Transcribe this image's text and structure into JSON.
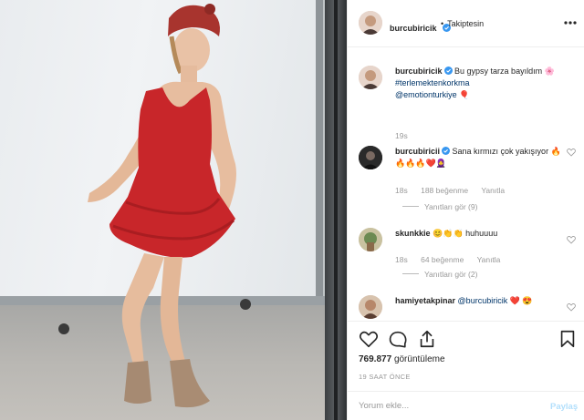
{
  "post": {
    "username": "burcubiricik",
    "follow_status": "Takiptesin",
    "caption": {
      "username": "burcubiricik",
      "text": "Bu gypsy tarza bayıldım 🌸",
      "hashtag": "#terlemektenkorkma",
      "mention": "@emotionturkiye 🎈",
      "age": "19s"
    }
  },
  "comments": [
    {
      "username": "burcubiricii",
      "text": "Sana kırmızı çok yakışıyor 🔥🔥🔥🔥❤️🧕",
      "age": "18s",
      "likes": "188 beğenme",
      "reply_label": "Yanıtla",
      "view_replies": "Yanıtları gör (9)"
    },
    {
      "username": "skunkkie",
      "text": "😊👏👏 huhuuuu",
      "age": "18s",
      "likes": "64 beğenme",
      "reply_label": "Yanıtla",
      "view_replies": "Yanıtları gör (2)"
    },
    {
      "username": "hamiyetakpinar",
      "mention": "@burcubiricik",
      "text": "❤️ 😍"
    }
  ],
  "stats": {
    "views_count": "769.877",
    "views_label": "görüntüleme",
    "timestamp": "19 SAAT ÖNCE"
  },
  "composer": {
    "placeholder": "Yorum ekle...",
    "post_label": "Paylaş"
  },
  "colors": {
    "verified_blue": "#3897f0",
    "link_blue": "#003569",
    "dress_red": "#c8262a"
  }
}
